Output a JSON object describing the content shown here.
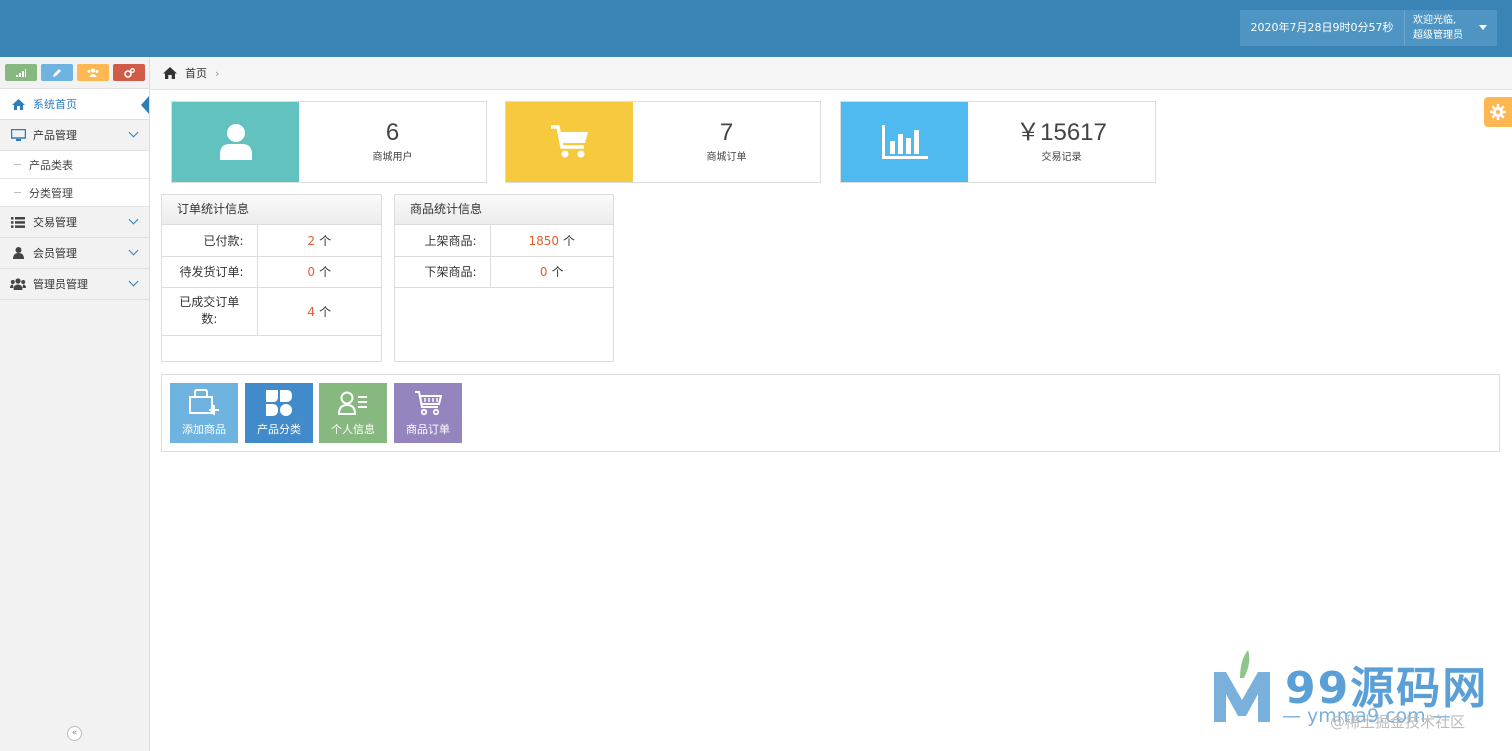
{
  "header": {
    "datetime": "2020年7月28日9时0分57秒",
    "welcome": "欢迎光临,",
    "role": "超级管理员"
  },
  "sidebar": {
    "shortcut_icons": [
      "signal-icon",
      "pencil-icon",
      "users-icon",
      "cogs-icon"
    ],
    "items": [
      {
        "label": "系统首页",
        "icon": "home-icon"
      },
      {
        "label": "产品管理",
        "icon": "desktop-icon"
      },
      {
        "label": "交易管理",
        "icon": "list-icon"
      },
      {
        "label": "会员管理",
        "icon": "user-icon"
      },
      {
        "label": "管理员管理",
        "icon": "group-icon"
      }
    ],
    "sub_items": [
      "产品类表",
      "分类管理"
    ],
    "collapse": "«"
  },
  "breadcrumb": {
    "home": "首页",
    "separator": "›"
  },
  "cards": [
    {
      "number": "6",
      "label": "商城用户",
      "color": "#62c2c0",
      "icon": "user-icon"
    },
    {
      "number": "7",
      "label": "商城订单",
      "color": "#f7c93f",
      "icon": "cart-icon"
    },
    {
      "number": "￥15617",
      "label": "交易记录",
      "color": "#4fbaf0",
      "icon": "bar-chart-icon"
    }
  ],
  "order_stats": {
    "title": "订单统计信息",
    "rows": [
      {
        "key": "已付款:",
        "value": "2",
        "unit": "个"
      },
      {
        "key": "待发货订单:",
        "value": "0",
        "unit": "个"
      },
      {
        "key": "已成交订单数:",
        "value": "4",
        "unit": "个"
      }
    ]
  },
  "product_stats": {
    "title": "商品统计信息",
    "rows": [
      {
        "key": "上架商品:",
        "value": "1850",
        "unit": "个"
      },
      {
        "key": "下架商品:",
        "value": "0",
        "unit": "个"
      }
    ]
  },
  "quick_buttons": [
    {
      "label": "添加商品",
      "color": "#6fb3e0",
      "icon": "bag-add-icon"
    },
    {
      "label": "产品分类",
      "color": "#428bca",
      "icon": "clover-icon"
    },
    {
      "label": "个人信息",
      "color": "#87b87f",
      "icon": "profile-icon"
    },
    {
      "label": "商品订单",
      "color": "#9585bf",
      "icon": "cart-icon"
    }
  ],
  "watermark": {
    "brand": "99源码网",
    "url": "— ymma9.com —",
    "community": "@稀土掘金技术社区"
  }
}
